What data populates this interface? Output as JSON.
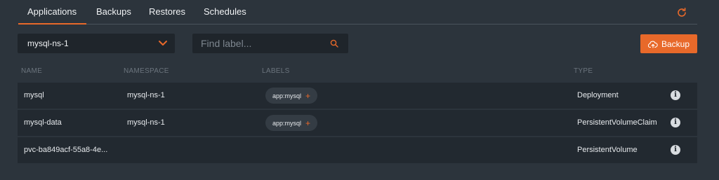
{
  "tabs": [
    {
      "label": "Applications",
      "active": true
    },
    {
      "label": "Backups",
      "active": false
    },
    {
      "label": "Restores",
      "active": false
    },
    {
      "label": "Schedules",
      "active": false
    }
  ],
  "namespace_select": {
    "value": "mysql-ns-1"
  },
  "search": {
    "placeholder": "Find label..."
  },
  "backup_button": {
    "label": "Backup"
  },
  "table": {
    "headers": {
      "name": "NAME",
      "namespace": "NAMESPACE",
      "labels": "LABELS",
      "type": "TYPE"
    },
    "rows": [
      {
        "name": "mysql",
        "namespace": "mysql-ns-1",
        "label": "app:mysql",
        "type": "Deployment"
      },
      {
        "name": "mysql-data",
        "namespace": "mysql-ns-1",
        "label": "app:mysql",
        "type": "PersistentVolumeClaim"
      },
      {
        "name": "pvc-ba849acf-55a8-4e...",
        "namespace": "",
        "label": "",
        "type": "PersistentVolume"
      }
    ]
  },
  "colors": {
    "accent": "#e8692a",
    "background": "#2c343c",
    "row": "#222930",
    "input": "#1f252b"
  },
  "icons": {
    "refresh": "refresh-icon",
    "chevron": "chevron-down-icon",
    "search": "search-icon",
    "upload": "cloud-upload-icon",
    "info": "info-icon"
  }
}
